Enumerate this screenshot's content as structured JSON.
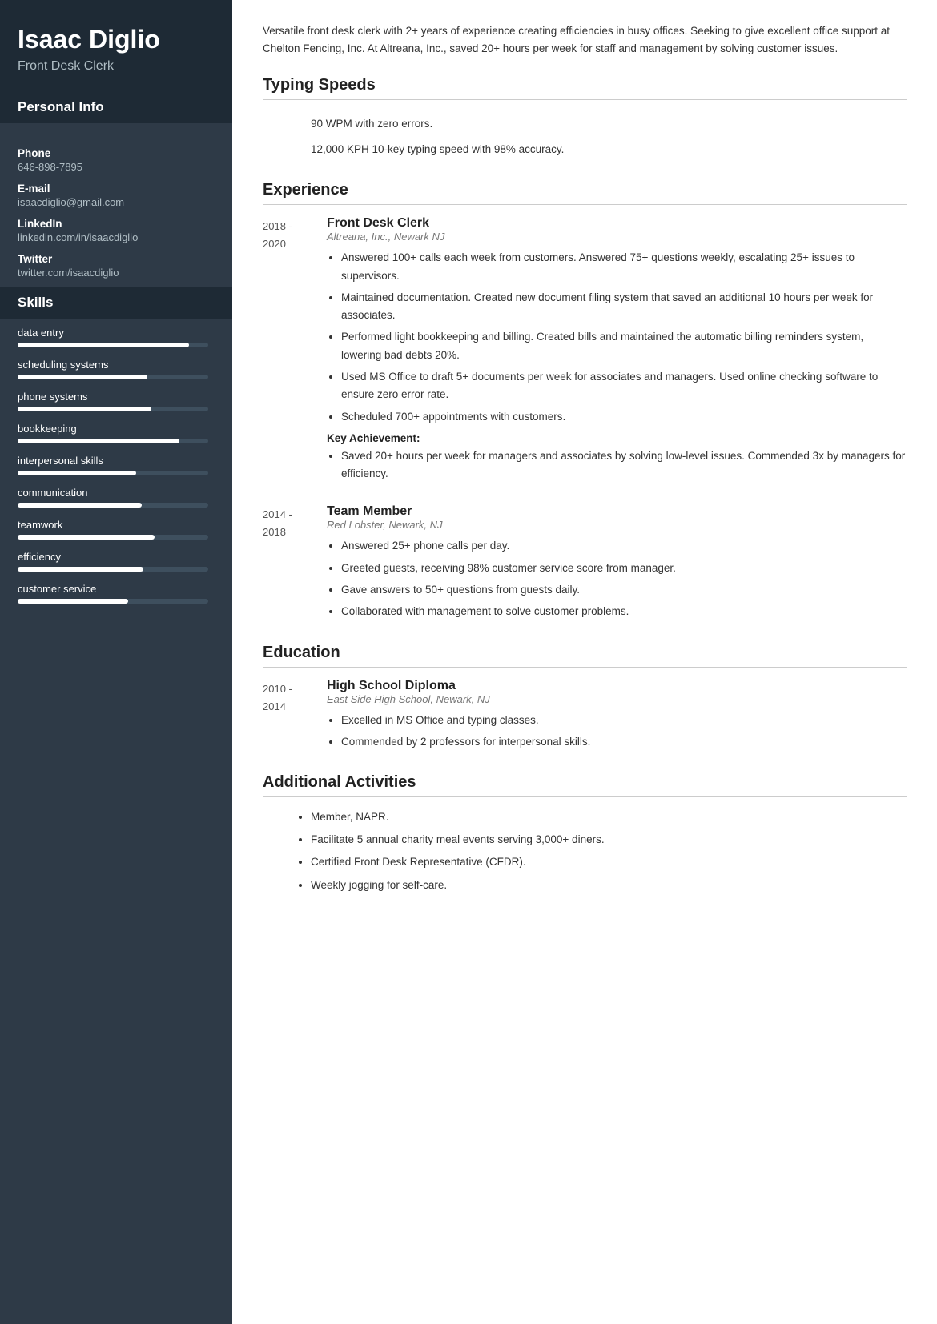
{
  "sidebar": {
    "name": "Isaac Diglio",
    "title": "Front Desk Clerk",
    "sections": {
      "personal_info_heading": "Personal Info",
      "phone_label": "Phone",
      "phone_value": "646-898-7895",
      "email_label": "E-mail",
      "email_value": "isaacdiglio@gmail.com",
      "linkedin_label": "LinkedIn",
      "linkedin_value": "linkedin.com/in/isaacdiglio",
      "twitter_label": "Twitter",
      "twitter_value": "twitter.com/isaacdiglio",
      "skills_heading": "Skills",
      "skills": [
        {
          "label": "data entry",
          "percent": 90
        },
        {
          "label": "scheduling systems",
          "percent": 68
        },
        {
          "label": "phone systems",
          "percent": 70
        },
        {
          "label": "bookkeeping",
          "percent": 85
        },
        {
          "label": "interpersonal skills",
          "percent": 62
        },
        {
          "label": "communication",
          "percent": 65
        },
        {
          "label": "teamwork",
          "percent": 72
        },
        {
          "label": "efficiency",
          "percent": 66
        },
        {
          "label": "customer service",
          "percent": 58
        }
      ]
    }
  },
  "main": {
    "summary": "Versatile front desk clerk with 2+ years of experience creating efficiencies in busy offices. Seeking to give excellent office support at Chelton Fencing, Inc. At Altreana, Inc., saved 20+ hours per week for staff and management by solving customer issues.",
    "typing_speeds": {
      "heading": "Typing Speeds",
      "items": [
        "90 WPM with zero errors.",
        "12,000 KPH 10-key typing speed with 98% accuracy."
      ]
    },
    "experience": {
      "heading": "Experience",
      "entries": [
        {
          "date_start": "2018 -",
          "date_end": "2020",
          "job_title": "Front Desk Clerk",
          "company": "Altreana, Inc., Newark NJ",
          "bullets": [
            "Answered 100+ calls each week from customers. Answered 75+ questions weekly, escalating 25+ issues to supervisors.",
            "Maintained documentation. Created new document filing system that saved an additional 10 hours per week for associates.",
            "Performed light bookkeeping and billing. Created bills and maintained the automatic billing reminders system, lowering bad debts 20%.",
            "Used MS Office to draft 5+ documents per week for associates and managers. Used online checking software to ensure zero error rate.",
            "Scheduled 700+ appointments with customers."
          ],
          "key_achievement_label": "Key Achievement:",
          "key_achievement_bullets": [
            "Saved 20+ hours per week for managers and associates by solving low-level issues. Commended 3x by managers for efficiency."
          ]
        },
        {
          "date_start": "2014 -",
          "date_end": "2018",
          "job_title": "Team Member",
          "company": "Red Lobster, Newark, NJ",
          "bullets": [
            "Answered 25+ phone calls per day.",
            "Greeted guests, receiving 98% customer service score from manager.",
            "Gave answers to 50+ questions from guests daily.",
            "Collaborated with management to solve customer problems."
          ],
          "key_achievement_label": null,
          "key_achievement_bullets": []
        }
      ]
    },
    "education": {
      "heading": "Education",
      "entries": [
        {
          "date_start": "2010 -",
          "date_end": "2014",
          "degree": "High School Diploma",
          "school": "East Side High School, Newark, NJ",
          "bullets": [
            "Excelled in MS Office and typing classes.",
            "Commended by 2 professors for interpersonal skills."
          ]
        }
      ]
    },
    "activities": {
      "heading": "Additional Activities",
      "items": [
        "Member, NAPR.",
        "Facilitate 5 annual charity meal events serving 3,000+ diners.",
        "Certified Front Desk Representative (CFDR).",
        "Weekly jogging for self-care."
      ]
    }
  }
}
